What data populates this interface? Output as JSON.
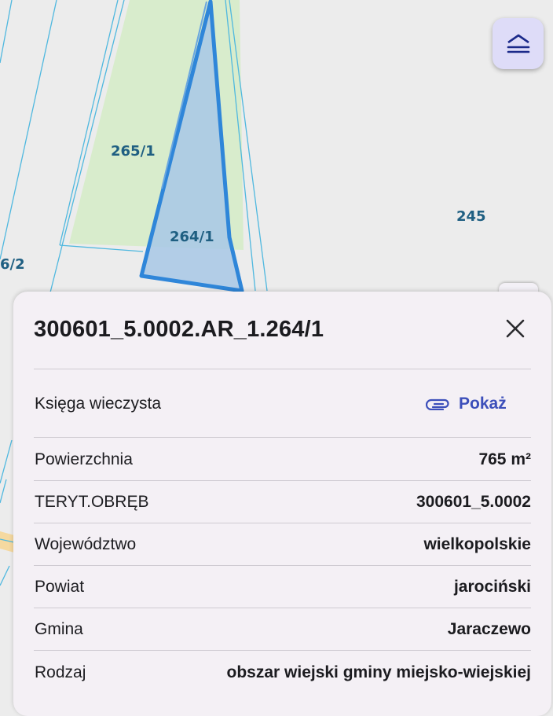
{
  "map": {
    "parcel_labels": [
      "265/1",
      "264/1",
      "245",
      "6/2"
    ],
    "colors": {
      "background": "#ececec",
      "parcel_line": "#4fb8df",
      "selected_fill": "#a8c8e6",
      "selected_stroke": "#2f86d9",
      "green_area": "#d8eccc",
      "road": "#f5d9a0"
    },
    "layers_icon": "layers-icon"
  },
  "panel": {
    "title": "300601_5.0002.AR_1.264/1",
    "close_icon": "close-icon",
    "land_register": {
      "label": "Księga wieczysta",
      "link_label": "Pokaż",
      "link_icon": "paperclip-icon",
      "link_color": "#3c4fba"
    },
    "rows": [
      {
        "label": "Powierzchnia",
        "value": "765 m²"
      },
      {
        "label": "TERYT.OBRĘB",
        "value": "300601_5.0002"
      },
      {
        "label": "Województwo",
        "value": "wielkopolskie"
      },
      {
        "label": "Powiat",
        "value": "jarociński"
      },
      {
        "label": "Gmina",
        "value": "Jaraczewo"
      },
      {
        "label": "Rodzaj",
        "value": "obszar wiejski gminy miejsko-wiejskiej"
      }
    ]
  }
}
